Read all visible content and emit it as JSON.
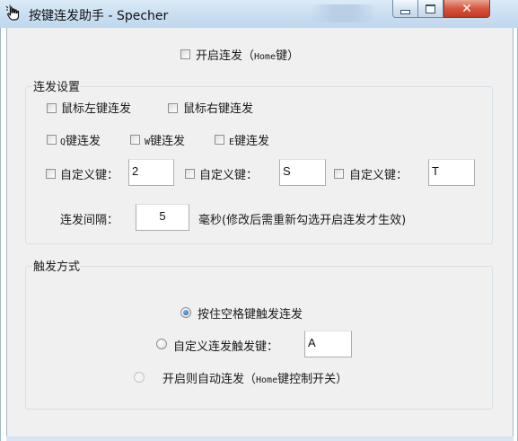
{
  "window": {
    "title": "按键连发助手 - Specher",
    "min_glyph": "–",
    "max_glyph": "□",
    "close_glyph": "✕"
  },
  "toggle": {
    "label": "开启连发（",
    "key_name": "Home",
    "key_suffix": "键）",
    "checked": false
  },
  "settings": {
    "group_label": "连发设置",
    "mouse": [
      {
        "label": "鼠标左键连发",
        "checked": false
      },
      {
        "label": "鼠标右键连发",
        "checked": false
      }
    ],
    "keys": [
      {
        "key": "Q",
        "label": "键连发",
        "checked": false
      },
      {
        "key": "W",
        "label": "键连发",
        "checked": false
      },
      {
        "key": "E",
        "label": "键连发",
        "checked": false
      }
    ],
    "custom": [
      {
        "label": "自定义键：",
        "value": "2",
        "checked": false
      },
      {
        "label": "自定义键：",
        "value": "S",
        "checked": false
      },
      {
        "label": "自定义键：",
        "value": "T",
        "checked": false
      }
    ],
    "interval": {
      "label": "连发间隔：",
      "value": "5",
      "unit": "毫秒(修改后需重新勾选开启连发才生效)"
    }
  },
  "trigger": {
    "group_label": "触发方式",
    "options": {
      "hold_space": {
        "label": "按住空格键触发连发",
        "selected": true
      },
      "custom_key": {
        "label": "自定义连发触发键：",
        "value": "A",
        "selected": false
      },
      "auto": {
        "label_pre": "开启则自动连发（",
        "key_name": "Home",
        "label_post": "键控制开关）",
        "selected": false
      }
    }
  },
  "colors": {
    "titlebar": "#c9def1",
    "client_bg": "#f0f0f0",
    "close_button": "#d7553f",
    "radio_selected": "#1f5ea8"
  },
  "icons": {
    "app": "hand-pointer-icon",
    "minimize": "minimize-icon",
    "maximize": "maximize-icon",
    "close": "close-icon"
  }
}
